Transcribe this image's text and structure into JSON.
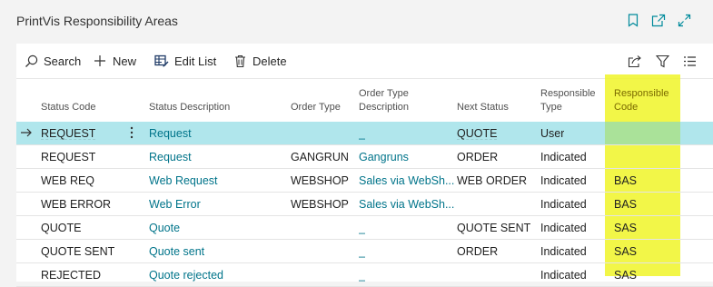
{
  "page": {
    "title": "PrintVis Responsibility Areas"
  },
  "actions": {
    "search": "Search",
    "new": "New",
    "edit_list": "Edit List",
    "delete": "Delete"
  },
  "columns": {
    "status_code": "Status Code",
    "status_description": "Status Description",
    "order_type": "Order Type",
    "order_type_description_1": "Order Type",
    "order_type_description_2": "Description",
    "next_status": "Next Status",
    "responsible_type_1": "Responsible",
    "responsible_type_2": "Type",
    "responsible_code_1": "Responsible",
    "responsible_code_2": "Code"
  },
  "rows": [
    {
      "status_code": "REQUEST",
      "status_description": "Request",
      "order_type": "",
      "order_type_description": "_",
      "next_status": "QUOTE",
      "responsible_type": "User",
      "responsible_code": ""
    },
    {
      "status_code": "REQUEST",
      "status_description": "Request",
      "order_type": "GANGRUN",
      "order_type_description": "Gangruns",
      "next_status": "ORDER",
      "responsible_type": "Indicated",
      "responsible_code": ""
    },
    {
      "status_code": "WEB REQ",
      "status_description": "Web Request",
      "order_type": "WEBSHOP",
      "order_type_description": "Sales via WebSh...",
      "next_status": "WEB ORDER",
      "responsible_type": "Indicated",
      "responsible_code": "BAS"
    },
    {
      "status_code": "WEB ERROR",
      "status_description": "Web Error",
      "order_type": "WEBSHOP",
      "order_type_description": "Sales via WebSh...",
      "next_status": "",
      "responsible_type": "Indicated",
      "responsible_code": "BAS"
    },
    {
      "status_code": "QUOTE",
      "status_description": "Quote",
      "order_type": "",
      "order_type_description": "_",
      "next_status": "QUOTE SENT",
      "responsible_type": "Indicated",
      "responsible_code": "SAS"
    },
    {
      "status_code": "QUOTE SENT",
      "status_description": "Quote sent",
      "order_type": "",
      "order_type_description": "_",
      "next_status": "ORDER",
      "responsible_type": "Indicated",
      "responsible_code": "SAS"
    },
    {
      "status_code": "REJECTED",
      "status_description": "Quote rejected",
      "order_type": "",
      "order_type_description": "_",
      "next_status": "",
      "responsible_type": "Indicated",
      "responsible_code": "SAS"
    }
  ],
  "colors": {
    "link": "#00748a",
    "selected_row": "#8ad8df",
    "highlight": "#f0f528"
  },
  "icons": [
    "bookmark-icon",
    "open-new-window-icon",
    "expand-icon",
    "search-icon",
    "plus-icon",
    "edit-list-icon",
    "delete-icon",
    "share-icon",
    "filter-icon",
    "list-view-icon",
    "row-arrow-icon",
    "row-menu-icon"
  ]
}
